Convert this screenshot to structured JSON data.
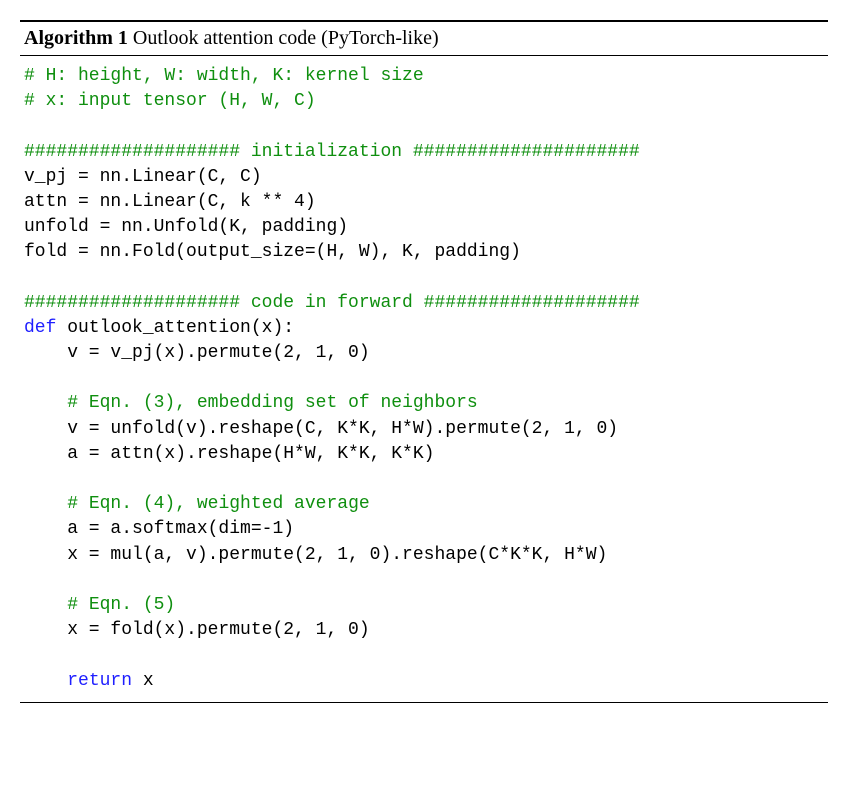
{
  "header": {
    "label": "Algorithm 1",
    "title": "Outlook attention code (PyTorch-like)"
  },
  "code": {
    "l01a": "# H: height, W: width, K: kernel size",
    "l02a": "# x: input tensor (H, W, C)",
    "blank1": "",
    "l04a": "#################### initialization #####################",
    "l05a": "v_pj = nn.Linear(C, C)",
    "l06a": "attn = nn.Linear(C, k ** 4)",
    "l07a": "unfold = nn.Unfold(K, padding)",
    "l08a": "fold = nn.Fold(output_size=(H, W), K, padding)",
    "blank2": "",
    "l10a": "#################### code in forward ####################",
    "l11def": "def",
    "l11rest": " outlook_attention(x):",
    "l12a": "    v = v_pj(x).permute(2, 1, 0)",
    "blank3": "",
    "l14a": "    ",
    "l14b": "# Eqn. (3), embedding set of neighbors",
    "l15a": "    v = unfold(v).reshape(C, K*K, H*W).permute(2, 1, 0)",
    "l16a": "    a = attn(x).reshape(H*W, K*K, K*K)",
    "blank4": "",
    "l18a": "    ",
    "l18b": "# Eqn. (4), weighted average",
    "l19a": "    a = a.softmax(dim=-1)",
    "l20a": "    x = mul(a, v).permute(2, 1, 0).reshape(C*K*K, H*W)",
    "blank5": "",
    "l22a": "    ",
    "l22b": "# Eqn. (5)",
    "l23a": "    x = fold(x).permute(2, 1, 0)",
    "blank6": "",
    "l25a": "    ",
    "l25ret": "return",
    "l25b": " x"
  }
}
